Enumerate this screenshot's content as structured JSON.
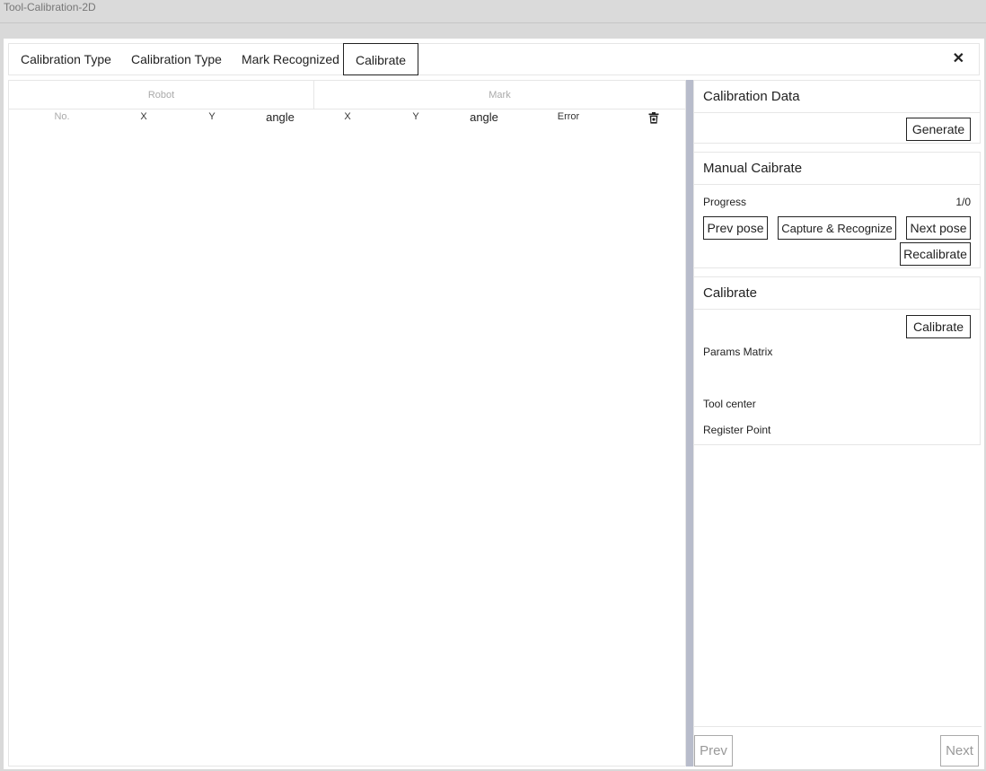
{
  "window": {
    "title": "Tool-Calibration-2D"
  },
  "tabs": [
    {
      "label": "Calibration Type"
    },
    {
      "label": "Calibration Type"
    },
    {
      "label": "Mark Recognized"
    },
    {
      "label": "Calibrate",
      "active": true
    }
  ],
  "close_icon": "close-icon",
  "table": {
    "groups": {
      "robot": "Robot",
      "mark": "Mark"
    },
    "columns": {
      "no": "No.",
      "robot_x": "X",
      "robot_y": "Y",
      "robot_angle": "angle",
      "mark_x": "X",
      "mark_y": "Y",
      "mark_angle": "angle",
      "error": "Error"
    },
    "delete_icon": "trash-icon",
    "rows": []
  },
  "calibration_data": {
    "title": "Calibration Data",
    "generate_label": "Generate"
  },
  "manual_calibrate": {
    "title": "Manual Caibrate",
    "progress_label": "Progress",
    "progress_value": "1/0",
    "prev_pose_label": "Prev pose",
    "capture_label": "Capture & Recognize",
    "next_pose_label": "Next pose",
    "recalibrate_label": "Recalibrate"
  },
  "calibrate": {
    "title": "Calibrate",
    "calibrate_label": "Calibrate",
    "params_matrix_label": "Params Matrix",
    "tool_center_label": "Tool center",
    "register_point_label": "Register Point"
  },
  "footer": {
    "prev_label": "Prev",
    "next_label": "Next"
  },
  "colors": {
    "splitter": "#b8bccb",
    "border": "#e6e6e6",
    "button_border": "#222222"
  }
}
